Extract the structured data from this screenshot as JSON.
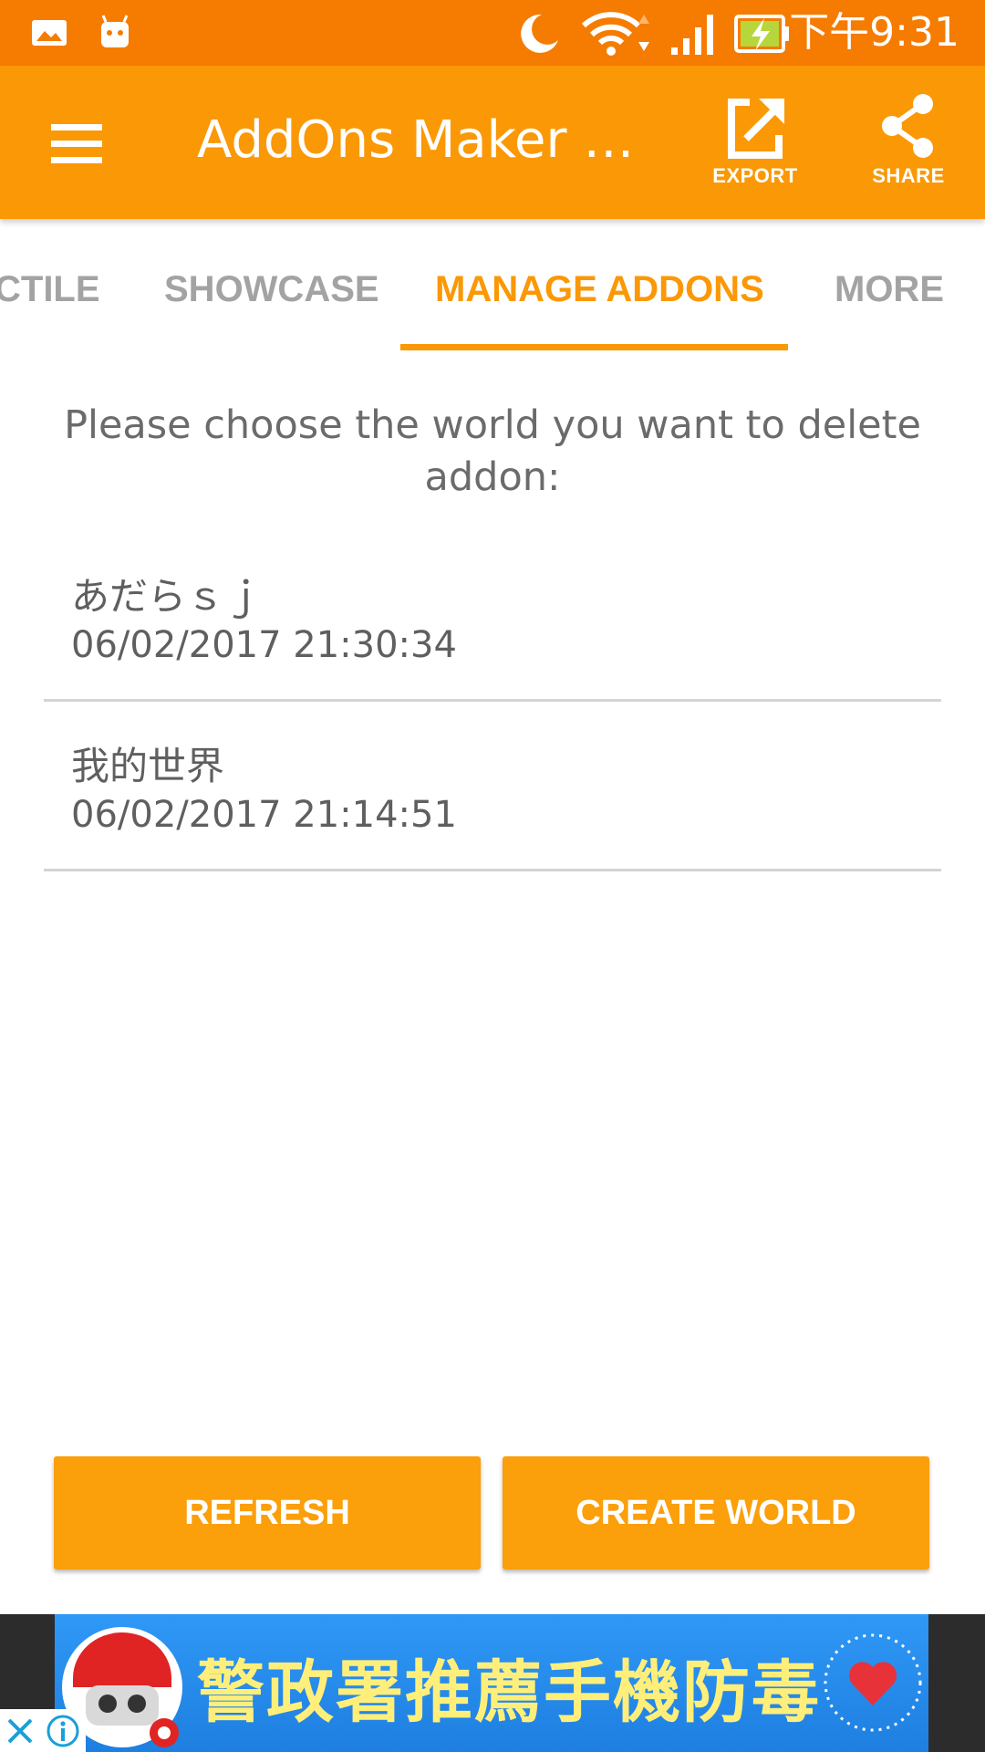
{
  "status_bar": {
    "time": "下午9:31",
    "icons": [
      "gallery-icon",
      "android-icon",
      "moon-icon",
      "wifi-icon",
      "signal-icon",
      "battery-charging-icon"
    ]
  },
  "app_bar": {
    "title": "AddOns Maker f...",
    "menu_icon": "hamburger-menu-icon",
    "actions": [
      {
        "label": "EXPORT",
        "icon": "export-icon"
      },
      {
        "label": "SHARE",
        "icon": "share-icon"
      }
    ]
  },
  "tabs": [
    {
      "label": "CTILE",
      "active": false
    },
    {
      "label": "SHOWCASE",
      "active": false
    },
    {
      "label": "MANAGE ADDONS",
      "active": true
    },
    {
      "label": "MORE",
      "active": false
    }
  ],
  "prompt": "Please choose the world you want to delete addon:",
  "worlds": [
    {
      "name": "あだらｓｊ",
      "date": "06/02/2017 21:30:34"
    },
    {
      "name": "我的世界",
      "date": "06/02/2017 21:14:51"
    }
  ],
  "buttons": {
    "refresh": "REFRESH",
    "create_world": "CREATE WORLD"
  },
  "ad": {
    "text": "警政署推薦手機防毒"
  },
  "colors": {
    "status_bar": "#f57c00",
    "primary": "#fb9805",
    "button": "#fb9f0a",
    "tab_inactive": "#a3a3a3",
    "text": "#5f5f5f"
  }
}
